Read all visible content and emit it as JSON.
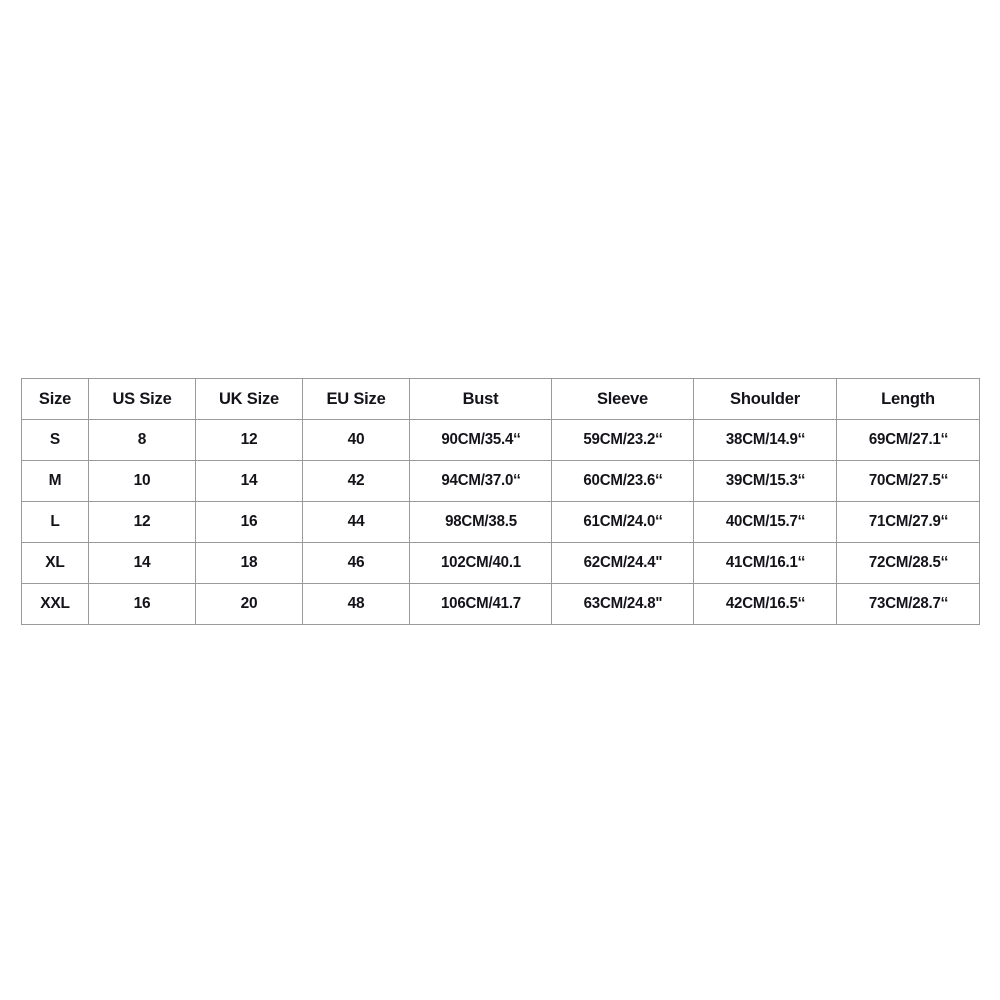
{
  "table": {
    "name": "size-chart",
    "border_color": "#9a9a9a",
    "background_color": "#ffffff",
    "text_color": "#15131a",
    "columns": [
      {
        "key": "size",
        "label": "Size"
      },
      {
        "key": "us_size",
        "label": "US Size"
      },
      {
        "key": "uk_size",
        "label": "UK Size"
      },
      {
        "key": "eu_size",
        "label": "EU Size"
      },
      {
        "key": "bust",
        "label": "Bust"
      },
      {
        "key": "sleeve",
        "label": "Sleeve"
      },
      {
        "key": "shoulder",
        "label": "Shoulder"
      },
      {
        "key": "length",
        "label": "Length"
      }
    ],
    "rows": [
      {
        "size": "S",
        "us_size": "8",
        "uk_size": "12",
        "eu_size": "40",
        "bust": "90CM/35.4‘‘",
        "sleeve": "59CM/23.2‘‘",
        "shoulder": "38CM/14.9‘‘",
        "length": "69CM/27.1‘‘"
      },
      {
        "size": "M",
        "us_size": "10",
        "uk_size": "14",
        "eu_size": "42",
        "bust": "94CM/37.0‘‘",
        "sleeve": "60CM/23.6‘‘",
        "shoulder": "39CM/15.3‘‘",
        "length": "70CM/27.5‘‘"
      },
      {
        "size": "L",
        "us_size": "12",
        "uk_size": "16",
        "eu_size": "44",
        "bust": "98CM/38.5",
        "sleeve": "61CM/24.0‘‘",
        "shoulder": "40CM/15.7‘‘",
        "length": "71CM/27.9‘‘"
      },
      {
        "size": "XL",
        "us_size": "14",
        "uk_size": "18",
        "eu_size": "46",
        "bust": "102CM/40.1",
        "sleeve": "62CM/24.4\"",
        "shoulder": "41CM/16.1‘‘",
        "length": "72CM/28.5‘‘"
      },
      {
        "size": "XXL",
        "us_size": "16",
        "uk_size": "20",
        "eu_size": "48",
        "bust": "106CM/41.7",
        "sleeve": "63CM/24.8\"",
        "shoulder": "42CM/16.5‘‘",
        "length": "73CM/28.7‘‘"
      }
    ]
  }
}
